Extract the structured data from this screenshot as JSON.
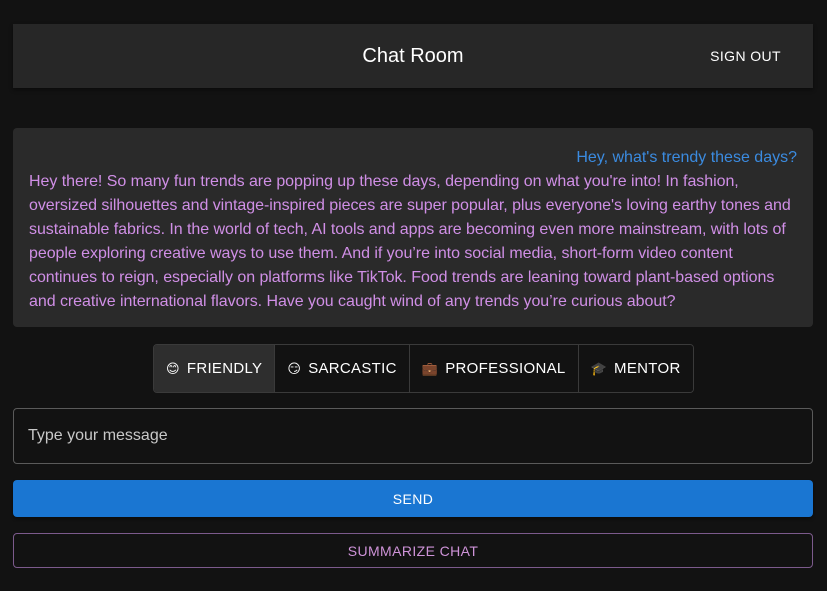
{
  "header": {
    "title": "Chat Room",
    "sign_out_label": "SIGN OUT"
  },
  "chat": {
    "messages": [
      {
        "role": "user",
        "text": "Hey, what's trendy these days?"
      },
      {
        "role": "bot",
        "text": "Hey there! So many fun trends are popping up these days, depending on what you're into! In fashion, oversized silhouettes and vintage-inspired pieces are super popular, plus everyone's loving earthy tones and sustainable fabrics. In the world of tech, AI tools and apps are becoming even more mainstream, with lots of people exploring creative ways to use them. And if you’re into social media, short-form video content continues to reign, especially on platforms like TikTok. Food trends are leaning toward plant-based options and creative international flavors. Have you caught wind of any trends you’re curious about?"
      }
    ]
  },
  "tones": [
    {
      "icon": "😊",
      "icon_name": "smiling-face-icon",
      "label": "FRIENDLY",
      "selected": true
    },
    {
      "icon": "😏",
      "icon_name": "smirking-face-icon",
      "label": "SARCASTIC",
      "selected": false
    },
    {
      "icon": "💼",
      "icon_name": "briefcase-icon",
      "label": "PROFESSIONAL",
      "selected": false
    },
    {
      "icon": "🎓",
      "icon_name": "graduation-cap-icon",
      "label": "MENTOR",
      "selected": false
    }
  ],
  "input": {
    "placeholder": "Type your message",
    "value": ""
  },
  "actions": {
    "send_label": "SEND",
    "summarize_label": "SUMMARIZE CHAT"
  },
  "colors": {
    "background": "#121212",
    "surface": "#272727",
    "user_text": "#3b8be0",
    "bot_text": "#d08fe6",
    "primary": "#1a76d2",
    "secondary": "#ce93d8"
  }
}
